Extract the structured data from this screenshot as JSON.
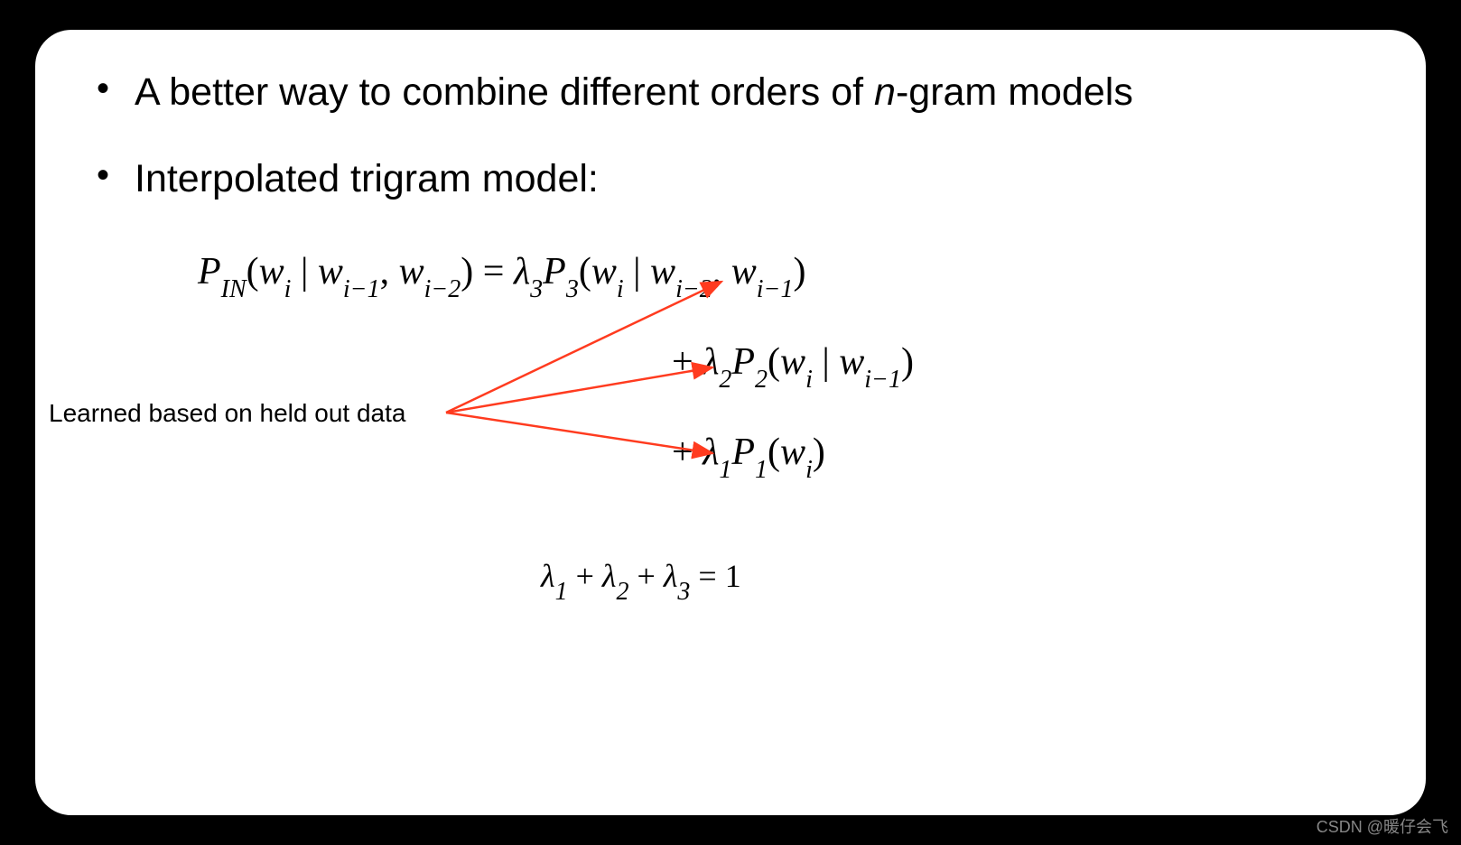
{
  "bullets": {
    "b1_prefix": "A better way to combine different orders of ",
    "b1_italic": "n",
    "b1_suffix": "-gram models",
    "b2": "Interpolated trigram model:"
  },
  "formula": {
    "line1_lhs": "P",
    "line1_lhs_sub": "IN",
    "line1_open": "(",
    "line1_w": "w",
    "line1_i": "i",
    "line1_bar": " | ",
    "line1_wi1": "w",
    "line1_i1": "i−1",
    "line1_comma": ", ",
    "line1_wi2": "w",
    "line1_i2": "i−2",
    "line1_close": ")",
    "line1_eq": " = ",
    "line1_lambda3": "λ",
    "line1_lambda3_sub": "3",
    "line1_P3": "P",
    "line1_P3_sub": "3",
    "line1_rhs_open": "(",
    "line1_rhs_w": "w",
    "line1_rhs_i": "i",
    "line1_rhs_bar": " | ",
    "line1_rhs_wi2": "w",
    "line1_rhs_i2": "i−2",
    "line1_rhs_comma": ", ",
    "line1_rhs_wi1": "w",
    "line1_rhs_i1": "i−1",
    "line1_rhs_close": ")",
    "line2_plus": "+ ",
    "line2_lambda": "λ",
    "line2_lambda_sub": "2",
    "line2_P": "P",
    "line2_P_sub": "2",
    "line2_open": "(",
    "line2_w": "w",
    "line2_i": "i",
    "line2_bar": " | ",
    "line2_wi1": "w",
    "line2_i1": "i−1",
    "line2_close": ")",
    "line3_plus": "+ ",
    "line3_lambda": "λ",
    "line3_lambda_sub": "1",
    "line3_P": "P",
    "line3_P_sub": "1",
    "line3_open": "(",
    "line3_w": "w",
    "line3_i": "i",
    "line3_close": ")",
    "constraint_l1": "λ",
    "constraint_l1s": "1",
    "constraint_p1": " + ",
    "constraint_l2": "λ",
    "constraint_l2s": "2",
    "constraint_p2": " + ",
    "constraint_l3": "λ",
    "constraint_l3s": "3",
    "constraint_eq": " = 1"
  },
  "annotation": "Learned based on held out data",
  "watermark": "CSDN @暖仔会飞"
}
